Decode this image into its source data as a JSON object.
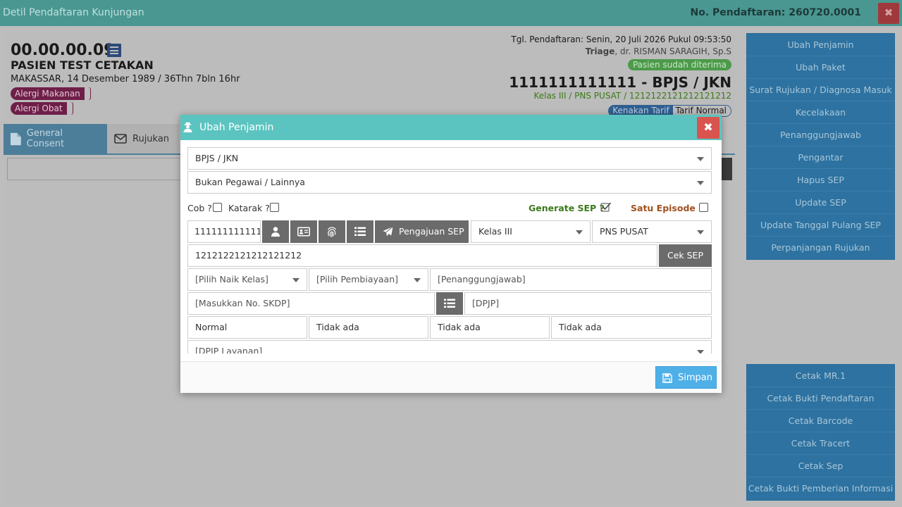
{
  "topbar": {
    "title": "Detil Pendaftaran Kunjungan",
    "registration_label": "No. Pendaftaran: 260720.0001",
    "close_symbol": "✖"
  },
  "patient": {
    "mr_number": "00.00.00.09",
    "name": "PASIEN TEST CETAKAN",
    "birth_info": "MAKASSAR, 14 Desember 1989 / 36Thn 7bln 16hr",
    "allergy_food": "Alergi Makanan",
    "allergy_drug": "Alergi Obat"
  },
  "registration": {
    "date_line": "Tgl. Pendaftaran: Senin, 20 Juli 2026 Pukul 09:53:50",
    "unit": "Triage",
    "doctor": ", dr. RISMAN SARAGIH, Sp.S",
    "status_badge": "Pasien sudah diterima",
    "card_number": "1111111111111 - BPJS / JKN",
    "class_line": "Kelas III / PNS PUSAT / 1212122121212121212",
    "tariff_label": "Kenakan Tarif",
    "tariff_value": "Tarif Normal"
  },
  "tabs": [
    {
      "label": "General Consent",
      "icon": "document-icon"
    },
    {
      "label": "Rujukan",
      "icon": "envelope-icon"
    }
  ],
  "side_menu_top": [
    "Ubah Penjamin",
    "Ubah Paket",
    "Surat Rujukan / Diagnosa Masuk",
    "Kecelakaan",
    "Penanggungjawab",
    "Pengantar",
    "Hapus SEP",
    "Update SEP",
    "Update Tanggal Pulang SEP",
    "Perpanjangan Rujukan"
  ],
  "side_menu_bottom": [
    "Cetak MR.1",
    "Cetak Bukti Pendaftaran",
    "Cetak Barcode",
    "Cetak Tracert",
    "Cetak Sep",
    "Cetak Bukti Pemberian Informasi"
  ],
  "modal": {
    "title": "Ubah Penjamin",
    "guarantor": "BPJS / JKN",
    "employee_type": "Bukan Pegawai / Lainnya",
    "cob_label": "Cob ?",
    "katarak_label": "Katarak ?",
    "generate_sep_label": "Generate SEP ?",
    "generate_sep_checked": true,
    "satu_episode_label": "Satu Episode ?",
    "card_number": "111111111111",
    "pengajuan_sep_label": "Pengajuan SEP",
    "class": "Kelas III",
    "membership": "PNS PUSAT",
    "sep_number": "1212122121212121212",
    "cek_sep_label": "Cek SEP",
    "naik_kelas_placeholder": "[Pilih Naik Kelas]",
    "pembiayaan_placeholder": "[Pilih Pembiayaan]",
    "penanggungjawab_placeholder": "[Penanggungjawab]",
    "skdp_placeholder": "[Masukkan No. SKDP]",
    "dpjp_placeholder": "[DPJP]",
    "status_fields": [
      "Normal",
      "Tidak ada",
      "Tidak ada",
      "Tidak ada"
    ],
    "dpjp_layanan_placeholder": "[DPJP Layanan]",
    "save_label": "Simpan"
  },
  "colors": {
    "modal_header": "#5bc4c0",
    "close_button": "#d9534f",
    "save_button": "#4fb0e8",
    "side_menu": "#2d72a0"
  }
}
